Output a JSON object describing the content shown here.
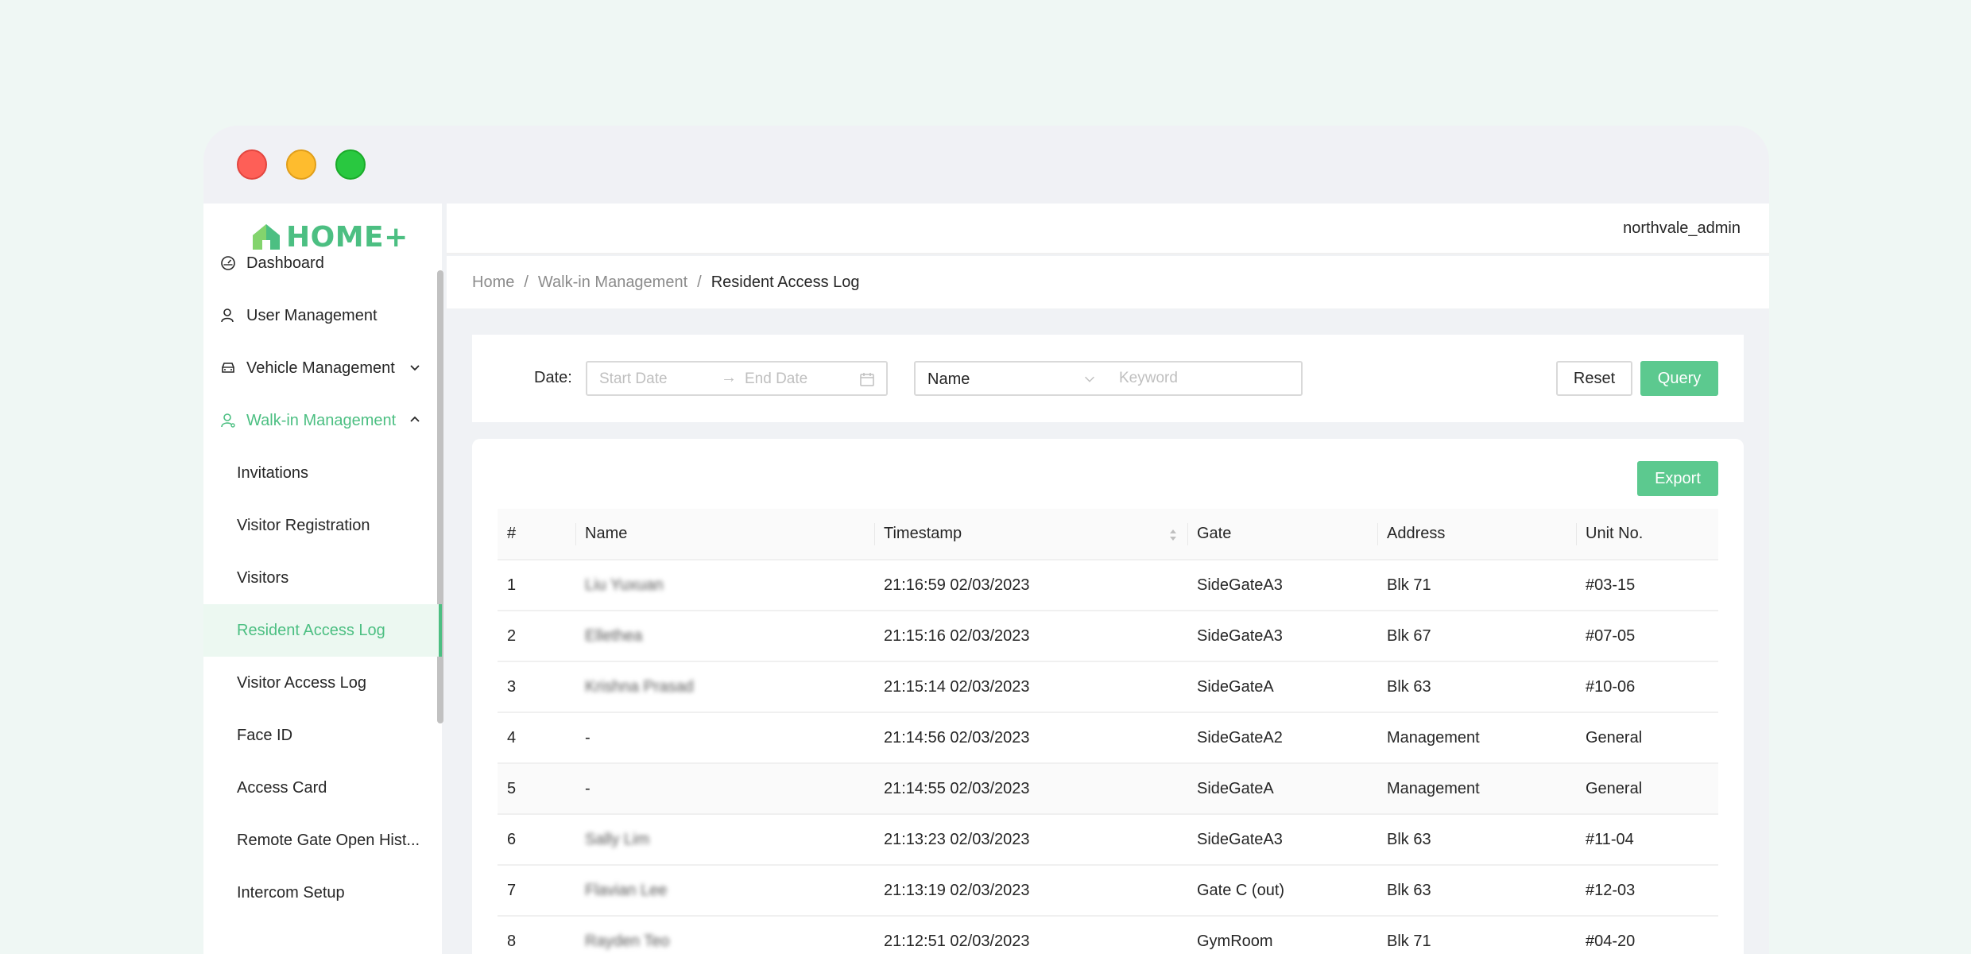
{
  "app": {
    "logo_text": "HOME+",
    "colors": {
      "accent": "#4cbf82",
      "accent_button": "#5cc98f",
      "active_bg": "#ecf8f1"
    }
  },
  "window_controls": [
    "close",
    "minimize",
    "maximize"
  ],
  "header": {
    "username": "northvale_admin"
  },
  "sidebar": {
    "items": [
      {
        "label": "Dashboard",
        "icon": "dashboard-icon"
      },
      {
        "label": "User Management",
        "icon": "user-icon"
      },
      {
        "label": "Vehicle Management",
        "icon": "car-icon",
        "state": "collapsed"
      },
      {
        "label": "Walk-in Management",
        "icon": "walk-in-user-icon",
        "state": "expanded"
      },
      {
        "label": "Invitations"
      },
      {
        "label": "Visitor Registration"
      },
      {
        "label": "Visitors"
      },
      {
        "label": "Resident Access Log",
        "active": true
      },
      {
        "label": "Visitor Access Log"
      },
      {
        "label": "Face ID"
      },
      {
        "label": "Access Card"
      },
      {
        "label": "Remote Gate Open Hist..."
      },
      {
        "label": "Intercom Setup"
      }
    ]
  },
  "breadcrumb": {
    "home": "Home",
    "section": "Walk-in Management",
    "current": "Resident Access Log",
    "separator": "/"
  },
  "filters": {
    "date_label": "Date",
    "start_placeholder": "Start Date",
    "end_placeholder": "End Date",
    "range_arrow": "→",
    "field_select": "Name",
    "keyword_placeholder": "Keyword",
    "reset_label": "Reset",
    "query_label": "Query"
  },
  "table": {
    "export_label": "Export",
    "columns": [
      "#",
      "Name",
      "Timestamp",
      "Gate",
      "Address",
      "Unit No."
    ],
    "rows": [
      {
        "num": "1",
        "name": "Liu Yuxuan",
        "name_blurred": true,
        "timestamp": "21:16:59 02/03/2023",
        "gate": "SideGateA3",
        "address": "Blk 71",
        "unit": "#03-15"
      },
      {
        "num": "2",
        "name": "Ellethea",
        "name_blurred": true,
        "timestamp": "21:15:16 02/03/2023",
        "gate": "SideGateA3",
        "address": "Blk 67",
        "unit": "#07-05"
      },
      {
        "num": "3",
        "name": "Krishna Prasad",
        "name_blurred": true,
        "timestamp": "21:15:14 02/03/2023",
        "gate": "SideGateA",
        "address": "Blk 63",
        "unit": "#10-06"
      },
      {
        "num": "4",
        "name": "-",
        "name_blurred": false,
        "timestamp": "21:14:56 02/03/2023",
        "gate": "SideGateA2",
        "address": "Management",
        "unit": "General"
      },
      {
        "num": "5",
        "name": "-",
        "name_blurred": false,
        "timestamp": "21:14:55 02/03/2023",
        "gate": "SideGateA",
        "address": "Management",
        "unit": "General"
      },
      {
        "num": "6",
        "name": "Sally Lim",
        "name_blurred": true,
        "timestamp": "21:13:23 02/03/2023",
        "gate": "SideGateA3",
        "address": "Blk 63",
        "unit": "#11-04"
      },
      {
        "num": "7",
        "name": "Flavian Lee",
        "name_blurred": true,
        "timestamp": "21:13:19 02/03/2023",
        "gate": "Gate C (out)",
        "address": "Blk 63",
        "unit": "#12-03"
      },
      {
        "num": "8",
        "name": "Rayden Teo",
        "name_blurred": true,
        "timestamp": "21:12:51 02/03/2023",
        "gate": "GymRoom",
        "address": "Blk 71",
        "unit": "#04-20"
      }
    ]
  }
}
